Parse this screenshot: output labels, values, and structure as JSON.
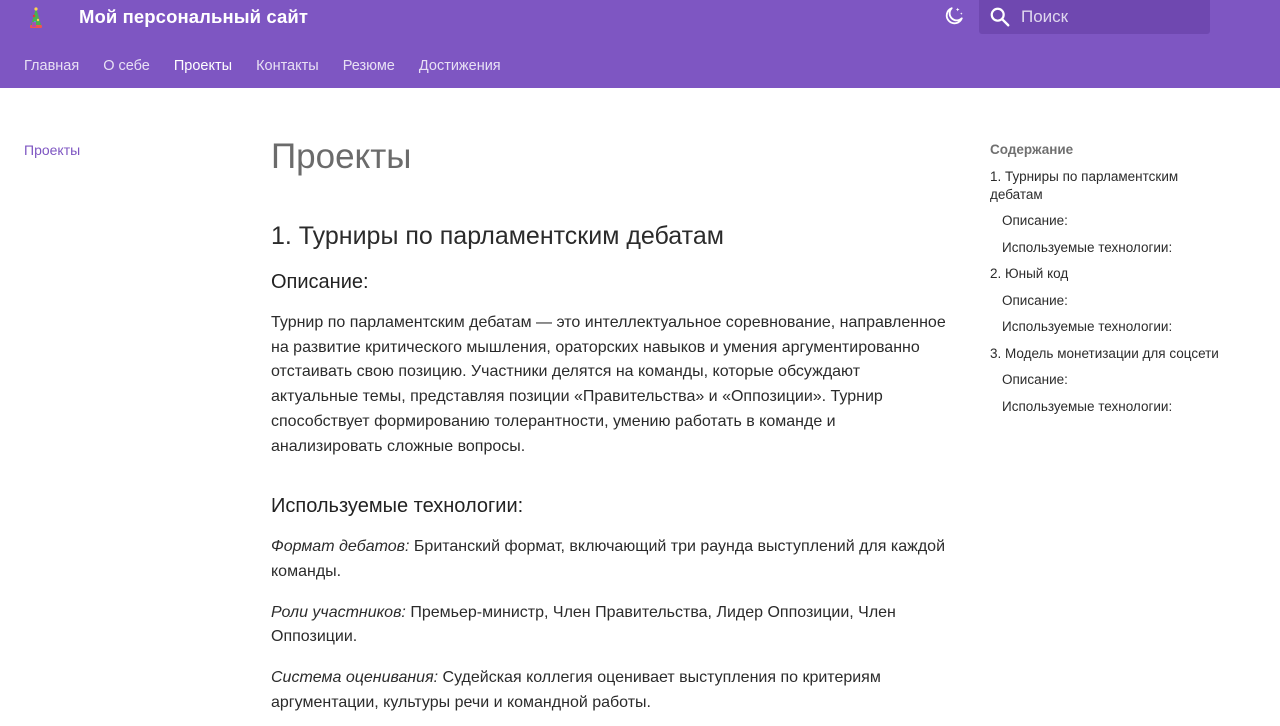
{
  "header": {
    "site_title": "Мой персональный сайт",
    "search_placeholder": "Поиск"
  },
  "nav": {
    "items": [
      {
        "label": "Главная",
        "active": false
      },
      {
        "label": "О себе",
        "active": false
      },
      {
        "label": "Проекты",
        "active": true
      },
      {
        "label": "Контакты",
        "active": false
      },
      {
        "label": "Резюме",
        "active": false
      },
      {
        "label": "Достижения",
        "active": false
      }
    ]
  },
  "left_nav": {
    "link": "Проекты"
  },
  "content": {
    "page_title": "Проекты",
    "section1": {
      "title": "1. Турниры по парламентским дебатам",
      "description_heading": "Описание:",
      "description": "Турнир по парламентским дебатам — это интеллектуальное соревнование, направленное на развитие критического мышления, ораторских навыков и умения аргументированно отстаивать свою позицию. Участники делятся на команды, которые обсуждают актуальные темы, представляя позиции «Правительства» и «Оппозиции». Турнир способствует формированию толерантности, умению работать в команде и анализировать сложные вопросы.",
      "tech_heading": "Используемые технологии:",
      "tech": [
        {
          "label": "Формат дебатов:",
          "text": " Британский формат, включающий три раунда выступлений для каждой команды."
        },
        {
          "label": "Роли участников:",
          "text": " Премьер-министр, Член Правительства, Лидер Оппозиции, Член Оппозиции."
        },
        {
          "label": "Система оценивания:",
          "text": " Судейская коллегия оценивает выступления по критериям аргументации, культуры речи и командной работы."
        }
      ]
    }
  },
  "toc": {
    "title": "Содержание",
    "items": [
      {
        "label": "1. Турниры по парламентским дебатам",
        "level": 1
      },
      {
        "label": "Описание:",
        "level": 2
      },
      {
        "label": "Используемые технологии:",
        "level": 2
      },
      {
        "label": "2. Юный код",
        "level": 1
      },
      {
        "label": "Описание:",
        "level": 2
      },
      {
        "label": "Используемые технологии:",
        "level": 2
      },
      {
        "label": "3. Модель монетизации для соцсети",
        "level": 1
      },
      {
        "label": "Описание:",
        "level": 2
      },
      {
        "label": "Используемые технологии:",
        "level": 2
      }
    ]
  },
  "colors": {
    "header_bg": "#7e56c2",
    "search_bg": "#6f48b0",
    "link": "#7e56c2"
  },
  "icons": {
    "logo": "site-logo-icon",
    "theme": "moon-icon",
    "search": "search-icon"
  }
}
